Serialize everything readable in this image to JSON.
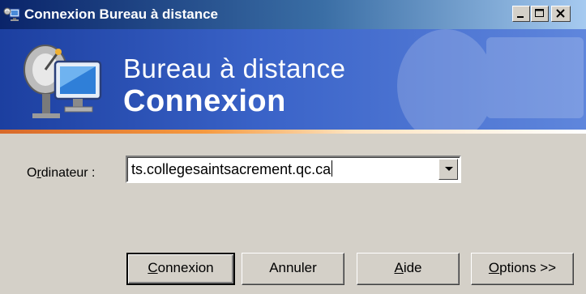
{
  "window": {
    "title": "Connexion Bureau à distance",
    "controls": [
      "minimize-icon",
      "maximize-icon",
      "close-icon"
    ]
  },
  "banner": {
    "line1": "Bureau à distance",
    "line2": "Connexion",
    "icon": "remote-desktop-icon"
  },
  "form": {
    "computer_label_pre": "O",
    "computer_label_accel": "r",
    "computer_label_post": "dinateur :",
    "computer_value": "ts.collegesaintsacrement.qc.ca"
  },
  "buttons": {
    "connect": {
      "accel": "C",
      "rest": "onnexion"
    },
    "cancel": {
      "label": "Annuler"
    },
    "help": {
      "accel": "A",
      "rest": "ide"
    },
    "options": {
      "accel": "O",
      "rest": "ptions >>"
    }
  },
  "colors": {
    "dialog_bg": "#d4d0c8",
    "titlebar_start": "#0a246a",
    "titlebar_end": "#a6caf0",
    "banner_blue": "#3a63c8",
    "accent_orange": "#f59a41"
  }
}
